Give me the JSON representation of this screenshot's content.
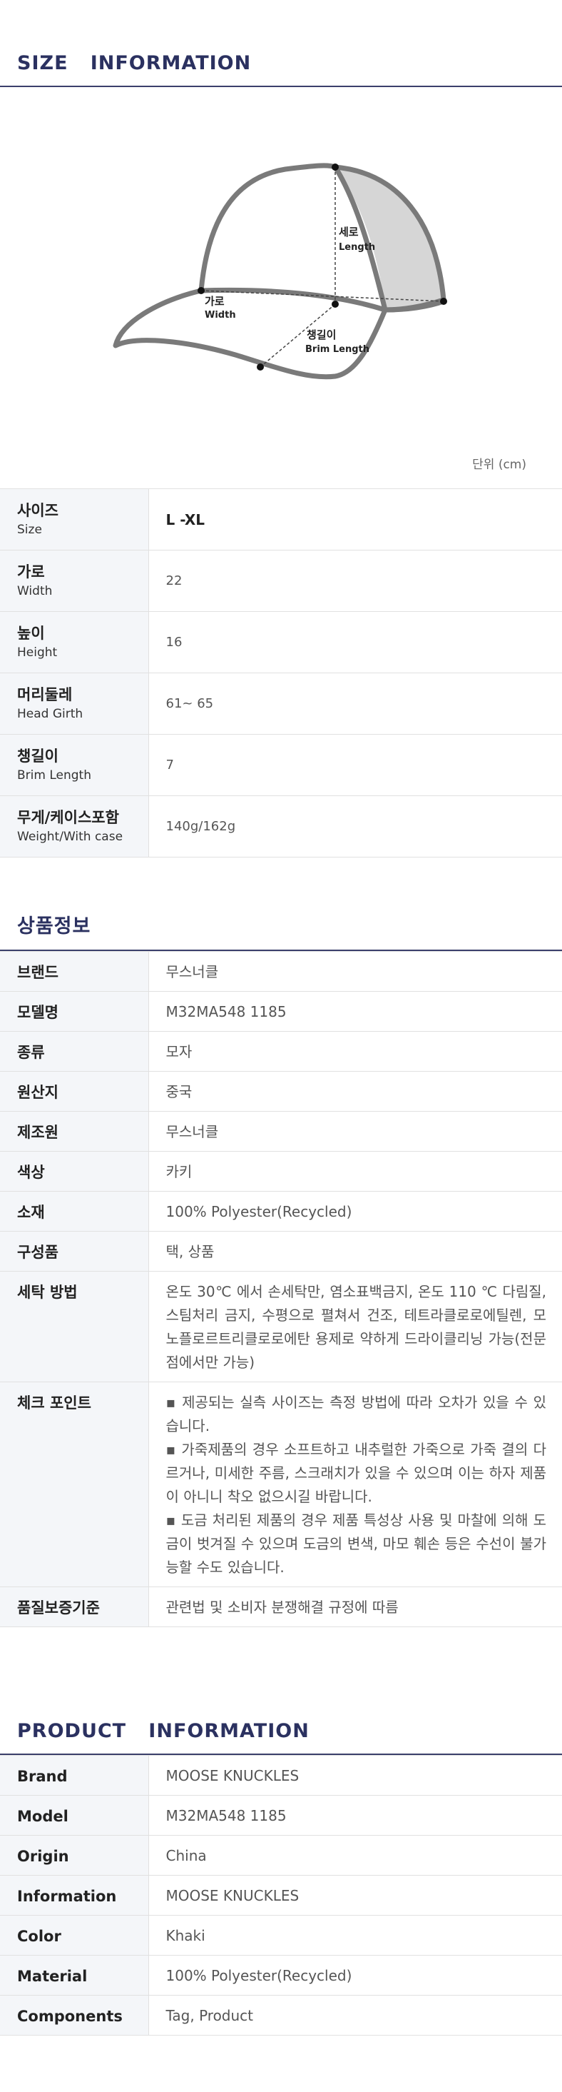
{
  "size_section": {
    "title": "SIZE   INFORMATION",
    "diagram_labels": {
      "height_ko": "세로",
      "height_en": "Length",
      "width_ko": "가로",
      "width_en": "Width",
      "brim_ko": "챙길이",
      "brim_en": "Brim Length"
    },
    "unit": "단위 (cm)",
    "rows": [
      {
        "ko": "사이즈",
        "en": "Size",
        "value": "L -XL"
      },
      {
        "ko": "가로",
        "en": "Width",
        "value": "22"
      },
      {
        "ko": "높이",
        "en": "Height",
        "value": "16"
      },
      {
        "ko": "머리둘레",
        "en": "Head Girth",
        "value": "61~ 65"
      },
      {
        "ko": "챙길이",
        "en": "Brim Length",
        "value": "7"
      },
      {
        "ko": "무게/케이스포함",
        "en": "Weight/With case",
        "value": "140g/162g"
      }
    ]
  },
  "product_info_ko": {
    "title": "상품정보",
    "rows": [
      {
        "label": "브랜드",
        "value": "무스너클"
      },
      {
        "label": "모델명",
        "value": "M32MA548 1185"
      },
      {
        "label": "종류",
        "value": "모자"
      },
      {
        "label": "원산지",
        "value": "중국"
      },
      {
        "label": "제조원",
        "value": "무스너클"
      },
      {
        "label": "색상",
        "value": "카키"
      },
      {
        "label": "소재",
        "value": "100%  Polyester(Recycled)"
      },
      {
        "label": "구성품",
        "value": "택, 상품"
      },
      {
        "label": "세탁 방법",
        "value": "온도 30℃ 에서 손세탁만, 염소표백금지, 온도 110 ℃ 다림질, 스팀처리 금지, 수평으로 펼쳐서 건조, 테트라클로로에틸렌, 모노플로르트리클로로에탄 용제로 약하게 드라이클리닝 가능(전문점에서만 가능)"
      },
      {
        "label": "체크 포인트",
        "value": "▪ 제공되는 실측 사이즈는 측정 방법에 따라 오차가 있을 수 있습니다.\n▪ 가죽제품의 경우 소프트하고 내추럴한 가죽으로 가죽 결의 다르거나, 미세한 주름, 스크래치가 있을 수 있으며 이는 하자 제품이 아니니 착오 없으시길 바랍니다.\n▪ 도금 처리된 제품의 경우 제품 특성상 사용 및 마찰에 의해 도금이 벗겨질 수 있으며 도금의 변색, 마모 훼손 등은 수선이 불가능할 수도 있습니다."
      },
      {
        "label": "품질보증기준",
        "value": "관련법 및 소비자 분쟁해결 규정에 따름"
      }
    ]
  },
  "product_info_en": {
    "title": "PRODUCT   INFORMATION",
    "rows": [
      {
        "label": "Brand",
        "value": "MOOSE  KNUCKLES"
      },
      {
        "label": "Model",
        "value": "M32MA548 1185"
      },
      {
        "label": "Origin",
        "value": "China"
      },
      {
        "label": "Information",
        "value": "MOOSE  KNUCKLES"
      },
      {
        "label": "Color",
        "value": "Khaki"
      },
      {
        "label": "Material",
        "value": "100%  Polyester(Recycled)"
      },
      {
        "label": "Components",
        "value": "Tag, Product"
      }
    ]
  },
  "colors": {
    "title": "#2b3160",
    "rule": "#3a3f6b",
    "label_bg": "#f4f6f9",
    "cap_outline": "#7a7a7a",
    "cap_fill": "#d6d6d6"
  }
}
